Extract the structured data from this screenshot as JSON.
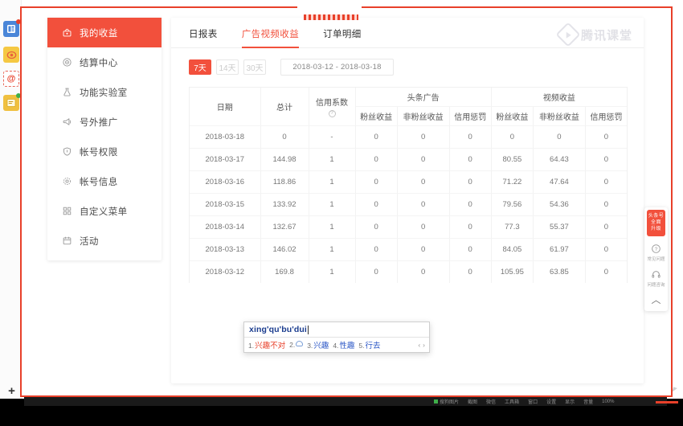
{
  "dock": {
    "items": [
      {
        "name": "panel-icon",
        "glyph": "▤",
        "badge": true
      },
      {
        "name": "weibo-eye-icon",
        "glyph": "◉",
        "badge": false
      },
      {
        "name": "at-mention-icon",
        "glyph": "@",
        "badge": false
      },
      {
        "name": "note-icon",
        "glyph": "▤",
        "badge": true
      }
    ],
    "add_label": "+"
  },
  "sidebar": {
    "items": [
      {
        "label": "我的收益",
        "icon": "wallet-icon",
        "active": true
      },
      {
        "label": "结算中心",
        "icon": "settlement-icon",
        "active": false
      },
      {
        "label": "功能实验室",
        "icon": "lab-flask-icon",
        "active": false
      },
      {
        "label": "号外推广",
        "icon": "megaphone-icon",
        "active": false
      },
      {
        "label": "帐号权限",
        "icon": "shield-icon",
        "active": false
      },
      {
        "label": "帐号信息",
        "icon": "gear-icon",
        "active": false
      },
      {
        "label": "自定义菜单",
        "icon": "grid-menu-icon",
        "active": false
      },
      {
        "label": "活动",
        "icon": "calendar-icon",
        "active": false
      }
    ]
  },
  "watermark": {
    "text": "腾讯课堂"
  },
  "tabs": [
    {
      "label": "日报表",
      "active": false
    },
    {
      "label": "广告视频收益",
      "active": true
    },
    {
      "label": "订单明细",
      "active": false
    }
  ],
  "filters": {
    "ranges": [
      {
        "label": "7天",
        "active": true
      },
      {
        "label": "14天",
        "active": false
      },
      {
        "label": "30天",
        "active": false
      }
    ],
    "date_range": "2018-03-12  -  2018-03-18"
  },
  "table": {
    "group_headers": [
      {
        "label": "日期",
        "rowspan": 2
      },
      {
        "label": "总计",
        "rowspan": 2
      },
      {
        "label": "信用系数",
        "rowspan": 2,
        "help": "?"
      },
      {
        "label": "头条广告",
        "colspan": 3
      },
      {
        "label": "视频收益",
        "colspan": 3
      }
    ],
    "sub_headers": [
      "粉丝收益",
      "非粉丝收益",
      "信用惩罚",
      "粉丝收益",
      "非粉丝收益",
      "信用惩罚"
    ],
    "rows": [
      [
        "2018-03-18",
        "0",
        "-",
        "0",
        "0",
        "0",
        "0",
        "0",
        "0"
      ],
      [
        "2018-03-17",
        "144.98",
        "1",
        "0",
        "0",
        "0",
        "80.55",
        "64.43",
        "0"
      ],
      [
        "2018-03-16",
        "118.86",
        "1",
        "0",
        "0",
        "0",
        "71.22",
        "47.64",
        "0"
      ],
      [
        "2018-03-15",
        "133.92",
        "1",
        "0",
        "0",
        "0",
        "79.56",
        "54.36",
        "0"
      ],
      [
        "2018-03-14",
        "132.67",
        "1",
        "0",
        "0",
        "0",
        "77.3",
        "55.37",
        "0"
      ],
      [
        "2018-03-13",
        "146.02",
        "1",
        "0",
        "0",
        "0",
        "84.05",
        "61.97",
        "0"
      ],
      [
        "2018-03-12",
        "169.8",
        "1",
        "0",
        "0",
        "0",
        "105.95",
        "63.85",
        "0"
      ]
    ]
  },
  "rail": {
    "promo": "头条号\n全面\n升级",
    "promo_lines": [
      "头条号",
      "全面",
      "升级"
    ],
    "items": [
      {
        "glyph": "?",
        "label": "常见问题",
        "name": "faq"
      },
      {
        "glyph": "☊",
        "label": "问题咨询",
        "name": "support"
      }
    ],
    "back_to_top": "︿"
  },
  "ime": {
    "input": "xing'qu'bu'dui",
    "candidates": [
      {
        "index": "1.",
        "text": "兴趣不对",
        "selected": true
      },
      {
        "index": "2.",
        "text": "",
        "cloud": true,
        "selected": false
      },
      {
        "index": "3.",
        "text": "兴趣",
        "selected": false
      },
      {
        "index": "4.",
        "text": "性趣",
        "selected": false
      },
      {
        "index": "5.",
        "text": "行去",
        "selected": false
      }
    ],
    "prev": "‹",
    "next": "›"
  },
  "taskbar": {
    "items": [
      "搜狗图片",
      "截图",
      "微信",
      "工具箱",
      "窗口",
      "设置",
      "显示",
      "音量",
      "100%"
    ]
  },
  "colors": {
    "accent": "#f2503c",
    "frame": "#e8402a",
    "link": "#2a56c6"
  }
}
